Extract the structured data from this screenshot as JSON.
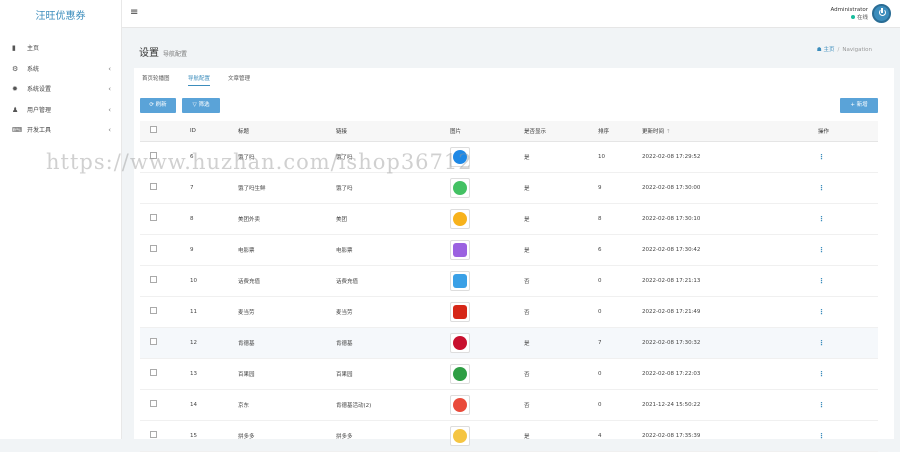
{
  "app": {
    "logo": "汪旺优惠券"
  },
  "sidebar": {
    "items": [
      {
        "label": "主页",
        "icon": "bar-chart-icon",
        "glyph": "▮",
        "arrow": ""
      },
      {
        "label": "系统",
        "icon": "gear-icon",
        "glyph": "⚙",
        "arrow": "‹"
      },
      {
        "label": "系统设置",
        "icon": "cog-icon",
        "glyph": "✹",
        "arrow": "‹"
      },
      {
        "label": "用户管理",
        "icon": "user-icon",
        "glyph": "♟",
        "arrow": "‹"
      },
      {
        "label": "开发工具",
        "icon": "keyboard-icon",
        "glyph": "⌨",
        "arrow": "‹"
      }
    ]
  },
  "header": {
    "menu_glyph": "≡",
    "user_name": "Administrator",
    "user_status": "在线"
  },
  "page": {
    "title": "设置",
    "subtitle": "导航配置",
    "breadcrumb_home": "主页",
    "breadcrumb_sep": "/",
    "breadcrumb_current": "Navigation"
  },
  "tabs": [
    {
      "label": "首页轮播图",
      "active": false
    },
    {
      "label": "导航配置",
      "active": true
    },
    {
      "label": "文章管理",
      "active": false
    }
  ],
  "toolbar": {
    "refresh_label": "刷新",
    "filter_label": "筛选",
    "add_label": "新增",
    "refresh_glyph": "⟳",
    "filter_glyph": "▽",
    "add_glyph": "+"
  },
  "table": {
    "headers": {
      "id": "ID",
      "title": "标题",
      "link": "链接",
      "image": "图片",
      "show": "是否显示",
      "sort": "排序",
      "updated": "更新时间",
      "actions": "操作",
      "sort_glyph": "↑"
    },
    "action_glyph": "⋮",
    "rows": [
      {
        "id": "6",
        "title": "饿了吗",
        "link": "饿了吗",
        "show": "是",
        "sort": "10",
        "updated": "2022-02-08 17:29:52",
        "icon_color": "#1e88e5"
      },
      {
        "id": "7",
        "title": "饿了吗生鲜",
        "link": "饿了吗",
        "show": "是",
        "sort": "9",
        "updated": "2022-02-08 17:30:00",
        "icon_color": "#43c163"
      },
      {
        "id": "8",
        "title": "美团外卖",
        "link": "美团",
        "show": "是",
        "sort": "8",
        "updated": "2022-02-08 17:30:10",
        "icon_color": "#f7b21c"
      },
      {
        "id": "9",
        "title": "电影票",
        "link": "电影票",
        "show": "是",
        "sort": "6",
        "updated": "2022-02-08 17:30:42",
        "icon_color": "#9b62e0"
      },
      {
        "id": "10",
        "title": "话费充值",
        "link": "话费充值",
        "show": "否",
        "sort": "0",
        "updated": "2022-02-08 17:21:13",
        "icon_color": "#3aa0e6"
      },
      {
        "id": "11",
        "title": "麦当劳",
        "link": "麦当劳",
        "show": "否",
        "sort": "0",
        "updated": "2022-02-08 17:21:49",
        "icon_color": "#d62718"
      },
      {
        "id": "12",
        "title": "肯德基",
        "link": "肯德基",
        "show": "是",
        "sort": "7",
        "updated": "2022-02-08 17:30:32",
        "icon_color": "#c8102e"
      },
      {
        "id": "13",
        "title": "百果园",
        "link": "百果园",
        "show": "否",
        "sort": "0",
        "updated": "2022-02-08 17:22:03",
        "icon_color": "#2e9e44"
      },
      {
        "id": "14",
        "title": "京东",
        "link": "肯德基活动(2)",
        "show": "否",
        "sort": "0",
        "updated": "2021-12-24 15:50:22",
        "icon_color": "#e94a3a"
      },
      {
        "id": "15",
        "title": "拼多多",
        "link": "拼多多",
        "show": "是",
        "sort": "4",
        "updated": "2022-02-08 17:35:39",
        "icon_color": "#f5c542"
      }
    ]
  },
  "watermark": {
    "text": "https://www.huzhan.com/ishop36712"
  }
}
